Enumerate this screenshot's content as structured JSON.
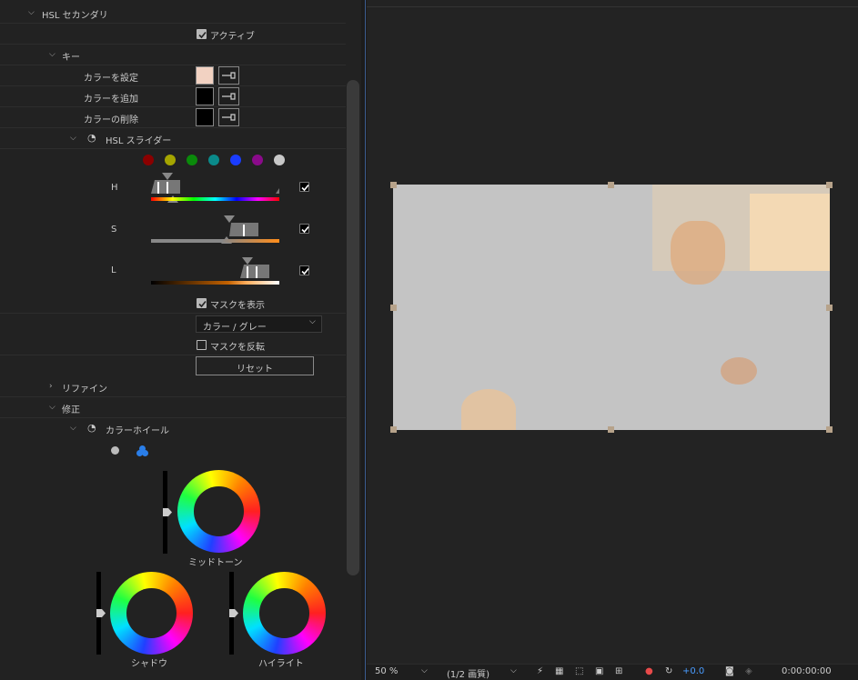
{
  "effect": {
    "section_title": "HSL セカンダリ",
    "active_label": "アクティブ",
    "key_label": "キー",
    "set_color_label": "カラーを設定",
    "add_color_label": "カラーを追加",
    "remove_color_label": "カラーの削除",
    "set_color_value": "#f2d2c2",
    "hsl_slider_label": "HSL スライダー",
    "preset_colors": [
      "#8b0000",
      "#a5a500",
      "#0a8a0a",
      "#0a8a8a",
      "#1a3cff",
      "#8a0a8a",
      "#c8c8c8"
    ],
    "h_label": "H",
    "s_label": "S",
    "l_label": "L",
    "show_mask_label": "マスクを表示",
    "mask_mode_value": "カラー / グレー",
    "invert_mask_label": "マスクを反転",
    "reset_label": "リセット",
    "refine_label": "リファイン",
    "correction_label": "修正",
    "color_wheel_label": "カラーホイール",
    "midtone_label": "ミッドトーン",
    "shadow_label": "シャドウ",
    "highlight_label": "ハイライト"
  },
  "viewer": {
    "zoom": "50 %",
    "quality": "(1/2 画質)",
    "exposure": "+0.0",
    "timecode": "0:00:00:00"
  }
}
